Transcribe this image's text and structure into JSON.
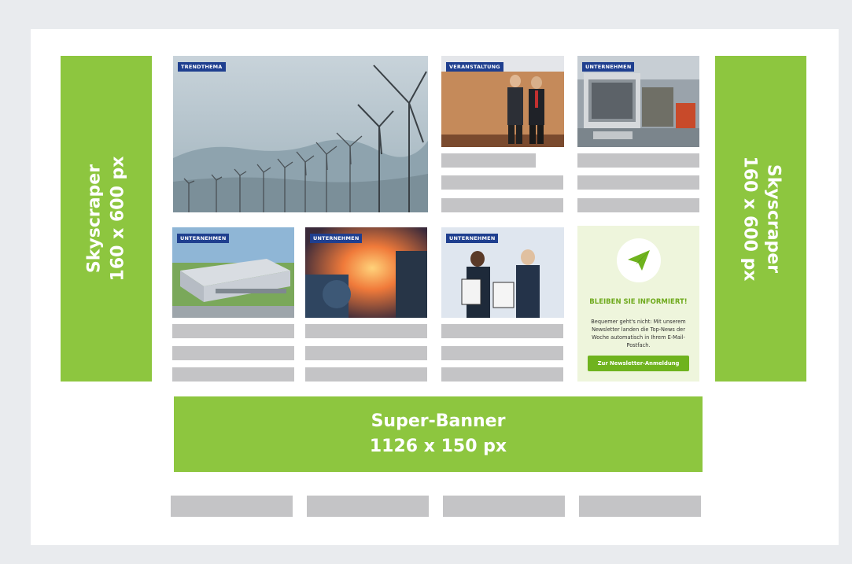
{
  "skyscraper_left": {
    "line1": "Skyscraper",
    "line2": "160 x 600 px"
  },
  "skyscraper_right": {
    "line1": "Skyscraper",
    "line2": "160 x 600 px"
  },
  "tiles": {
    "trend": {
      "tag": "TRENDTHEMA",
      "scene": "wind-turbines-photo"
    },
    "event": {
      "tag": "VERANSTALTUNG",
      "scene": "two-men-on-stage-photo"
    },
    "company_top": {
      "tag": "UNTERNEHMEN",
      "scene": "industrial-furnace-photo"
    },
    "company_factory": {
      "tag": "UNTERNEHMEN",
      "scene": "factory-aerial-photo"
    },
    "company_steel": {
      "tag": "UNTERNEHMEN",
      "scene": "glowing-steel-photo"
    },
    "company_award": {
      "tag": "UNTERNEHMEN",
      "scene": "award-certificates-photo"
    }
  },
  "newsletter": {
    "icon": "paper-plane-icon",
    "title": "BLEIBEN SIE INFORMIERT!",
    "body": "Bequemer geht's nicht: Mit unserem Newsletter landen die Top-News der Woche automatisch in Ihrem E-Mail-Postfach.",
    "button": "Zur Newsletter-Anmeldung"
  },
  "banner": {
    "line1": "Super-Banner",
    "line2": "1126 x 150 px"
  },
  "colors": {
    "ad_green": "#8dc63f",
    "tag_blue": "#1f3f8f",
    "placeholder_gray": "#c4c4c6",
    "newsletter_bg": "#eef5dc",
    "button_green": "#6fb31e"
  }
}
